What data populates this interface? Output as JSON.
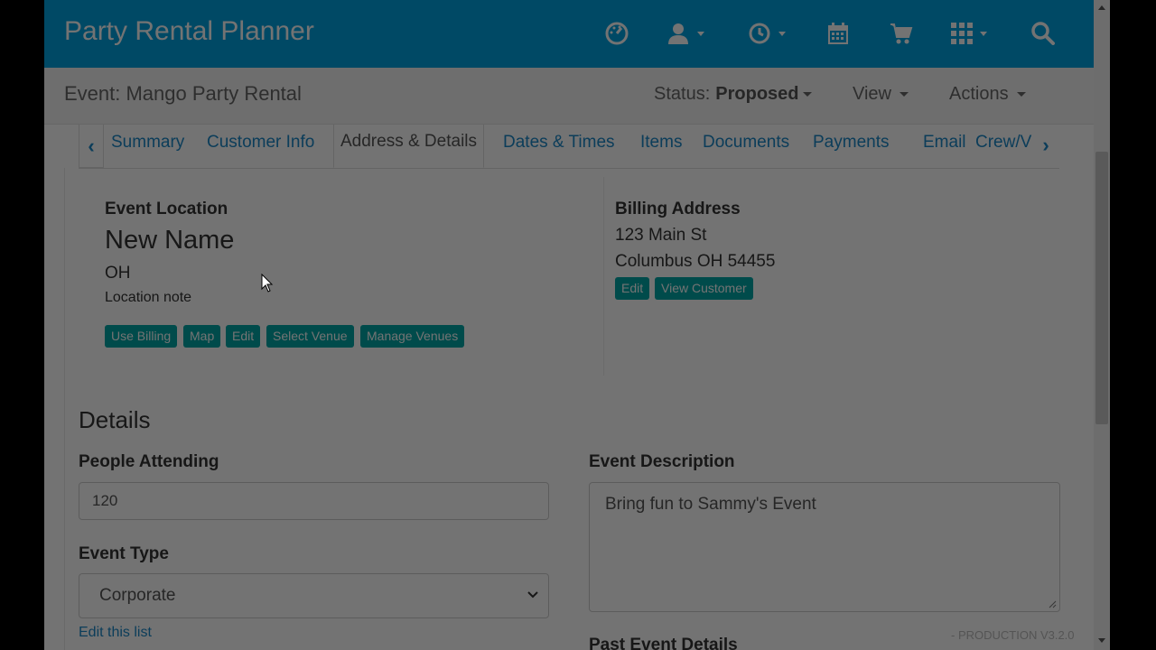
{
  "app": {
    "brand": "Party Rental Planner"
  },
  "navbar": {
    "icons": [
      "dashboard-icon",
      "user-icon",
      "clock-icon",
      "calendar-icon",
      "cart-icon",
      "apps-grid-icon",
      "search-icon"
    ]
  },
  "event": {
    "title": "Event: Mango Party Rental",
    "status_label": "Status:",
    "status_value": "Proposed",
    "view_label": "View",
    "actions_label": "Actions"
  },
  "tabs": [
    "Summary",
    "Customer Info",
    "Address & Details",
    "Dates & Times",
    "Items",
    "Documents",
    "Payments",
    "Email",
    "Crew/V"
  ],
  "active_tab": "Address & Details",
  "location": {
    "heading": "Event Location",
    "name": "New Name",
    "state": "OH",
    "note": "Location note",
    "buttons": [
      "Use Billing",
      "Map",
      "Edit",
      "Select Venue",
      "Manage Venues"
    ]
  },
  "billing": {
    "heading": "Billing Address",
    "line1": "123 Main St",
    "line2": "Columbus OH 54455",
    "buttons": [
      "Edit",
      "View Customer"
    ]
  },
  "details": {
    "heading": "Details",
    "people_label": "People Attending",
    "people_value": "120",
    "type_label": "Event Type",
    "type_value": "Corporate",
    "edit_list_link": "Edit this list",
    "description_label": "Event Description",
    "description_value": "Bring fun to Sammy's Event",
    "past_label": "Past Event Details"
  },
  "footer": {
    "version": "- PRODUCTION V3.2.0"
  },
  "colors": {
    "primary": "#00a3e0",
    "button": "#00a6a6",
    "link": "#1b88c7"
  }
}
